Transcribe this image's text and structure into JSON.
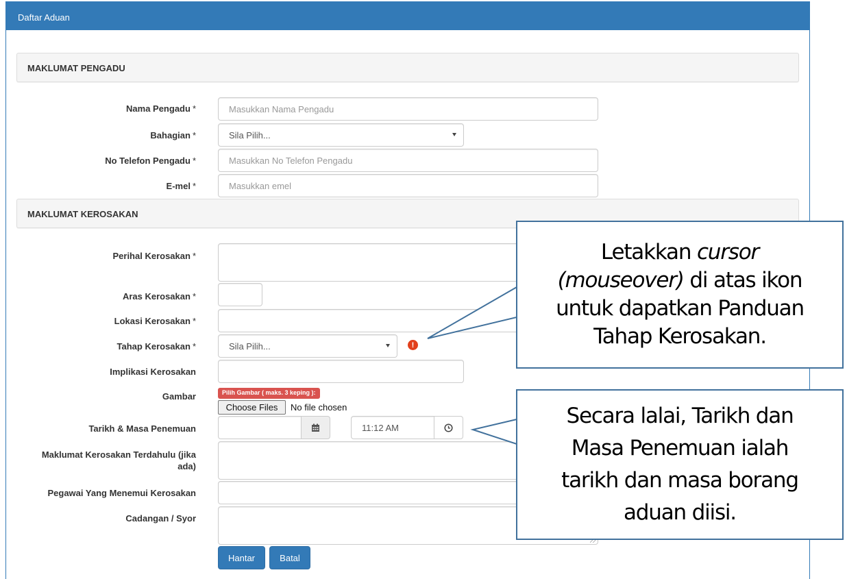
{
  "header": {
    "title": "Daftar Aduan"
  },
  "sections": {
    "pengadu": "MAKLUMAT PENGADU",
    "kerosakan": "MAKLUMAT KEROSAKAN"
  },
  "required_mark": "*",
  "pengadu": {
    "nama_label": "Nama Pengadu",
    "nama_placeholder": "Masukkan Nama Pengadu",
    "bahagian_label": "Bahagian",
    "bahagian_value": "Sila Pilih...",
    "telefon_label": "No Telefon Pengadu",
    "telefon_placeholder": "Masukkan No Telefon Pengadu",
    "emel_label": "E-mel",
    "emel_placeholder": "Masukkan emel"
  },
  "kerosakan": {
    "perihal_label": "Perihal Kerosakan",
    "aras_label": "Aras Kerosakan",
    "lokasi_label": "Lokasi Kerosakan",
    "tahap_label": "Tahap Kerosakan",
    "tahap_value": "Sila Pilih...",
    "implikasi_label": "Implikasi Kerosakan",
    "gambar_label": "Gambar",
    "gambar_badge": "Pilih Gambar ( maks. 3 keping ):",
    "choose_files": "Choose Files",
    "no_file": "No file chosen",
    "tarikh_label": "Tarikh & Masa Penemuan",
    "masa_value": "11:12 AM",
    "terdahulu_label_line1": "Maklumat Kerosakan Terdahulu (jika",
    "terdahulu_label_line2": "ada)",
    "pegawai_label": "Pegawai Yang Menemui Kerosakan",
    "cadangan_label": "Cadangan / Syor"
  },
  "buttons": {
    "hantar": "Hantar",
    "batal": "Batal"
  },
  "callouts": {
    "tahap": {
      "line1_a": "Letakkan ",
      "line1_b": "cursor",
      "line2_a": "(mouseover)",
      "line2_b": " di atas ikon",
      "line3": "untuk dapatkan Panduan",
      "line4": "Tahap Kerosakan."
    },
    "tarikh": {
      "line1": "Secara lalai, Tarikh dan",
      "line2": "Masa Penemuan ialah",
      "line3": "tarikh dan masa borang",
      "line4": "aduan diisi."
    }
  },
  "colors": {
    "primary": "#337ab7",
    "danger": "#d9534f",
    "callout_border": "#41719c"
  }
}
